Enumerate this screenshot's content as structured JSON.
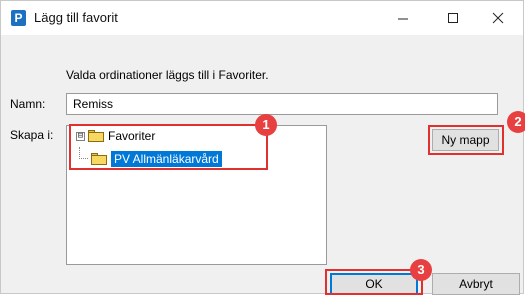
{
  "window": {
    "app_icon_letter": "P",
    "title": "Lägg till favorit"
  },
  "message": "Valda ordinationer läggs till i Favoriter.",
  "name_field": {
    "label": "Namn:",
    "value": "Remiss"
  },
  "location": {
    "label": "Skapa i:",
    "tree": {
      "root": {
        "expander": "⊟",
        "label": "Favoriter"
      },
      "child": {
        "label": "PV Allmänläkarvård",
        "selected": true
      }
    }
  },
  "buttons": {
    "new_folder": "Ny mapp",
    "ok": "OK",
    "cancel": "Avbryt"
  },
  "annotations": {
    "badge_1": "1",
    "badge_2": "2",
    "badge_3": "3",
    "color": "#e84040"
  },
  "colors": {
    "selection": "#0078d7",
    "folder": "#f7d860"
  }
}
